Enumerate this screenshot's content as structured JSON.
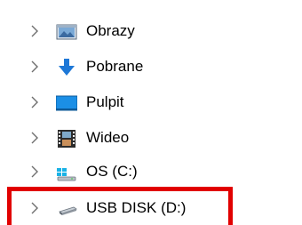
{
  "colors": {
    "highlight": "#e10000",
    "chevron": "#6e6e6e"
  },
  "tree": {
    "items": [
      {
        "label": "Obrazy",
        "icon": "pictures-folder-icon"
      },
      {
        "label": "Pobrane",
        "icon": "download-arrow-icon"
      },
      {
        "label": "Pulpit",
        "icon": "desktop-folder-icon"
      },
      {
        "label": "Wideo",
        "icon": "video-filmstrip-icon"
      },
      {
        "label": "OS (C:)",
        "icon": "windows-drive-icon"
      },
      {
        "label": "USB DISK (D:)",
        "icon": "usb-drive-icon"
      }
    ]
  }
}
